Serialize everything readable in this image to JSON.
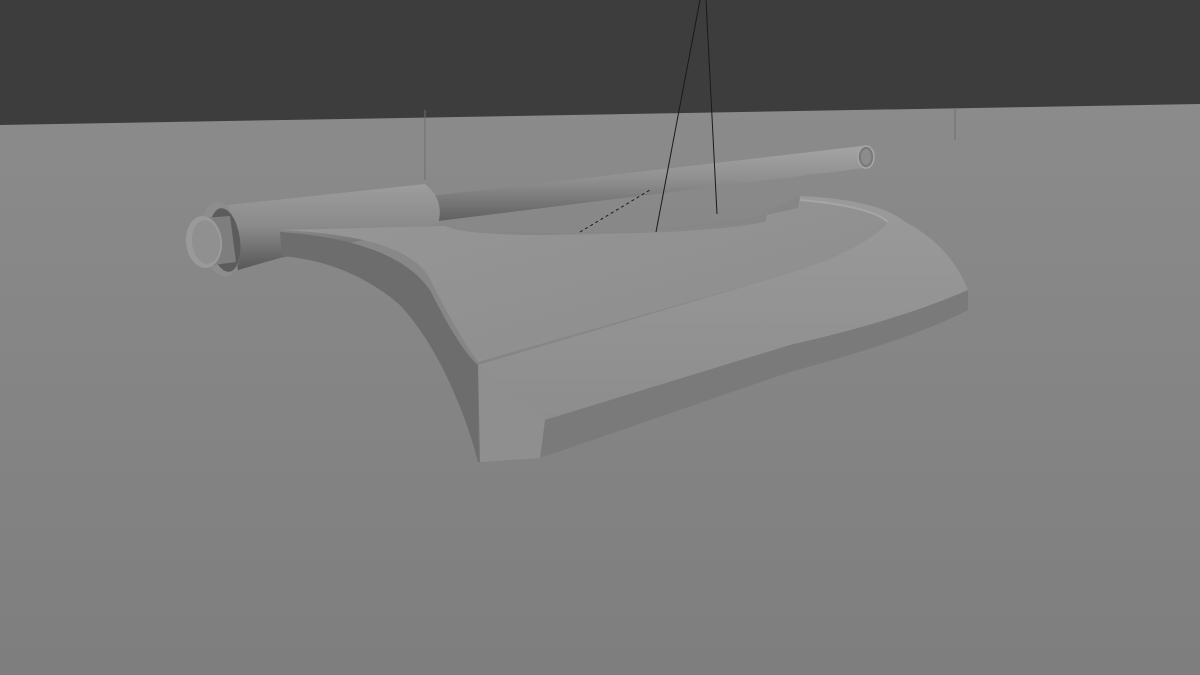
{
  "viewport": {
    "shading": "solid",
    "colors": {
      "background": "#3d3d3d",
      "ground_far": "#8a8a8a",
      "ground_near": "#7f7f7f",
      "blade_top": "#929292",
      "blade_side": "#6e6e6e",
      "handle": "#8e8e8e",
      "helper_line": "#1a1a1a"
    }
  },
  "objects": {
    "ground_plane": {
      "name": "ground-plane"
    },
    "axe": {
      "name": "axe-model",
      "parts": [
        "blade",
        "bevel-edge",
        "handle-shaft",
        "handle-collar",
        "pommel"
      ]
    },
    "camera_guides": {
      "name": "camera-guide-lines"
    }
  }
}
